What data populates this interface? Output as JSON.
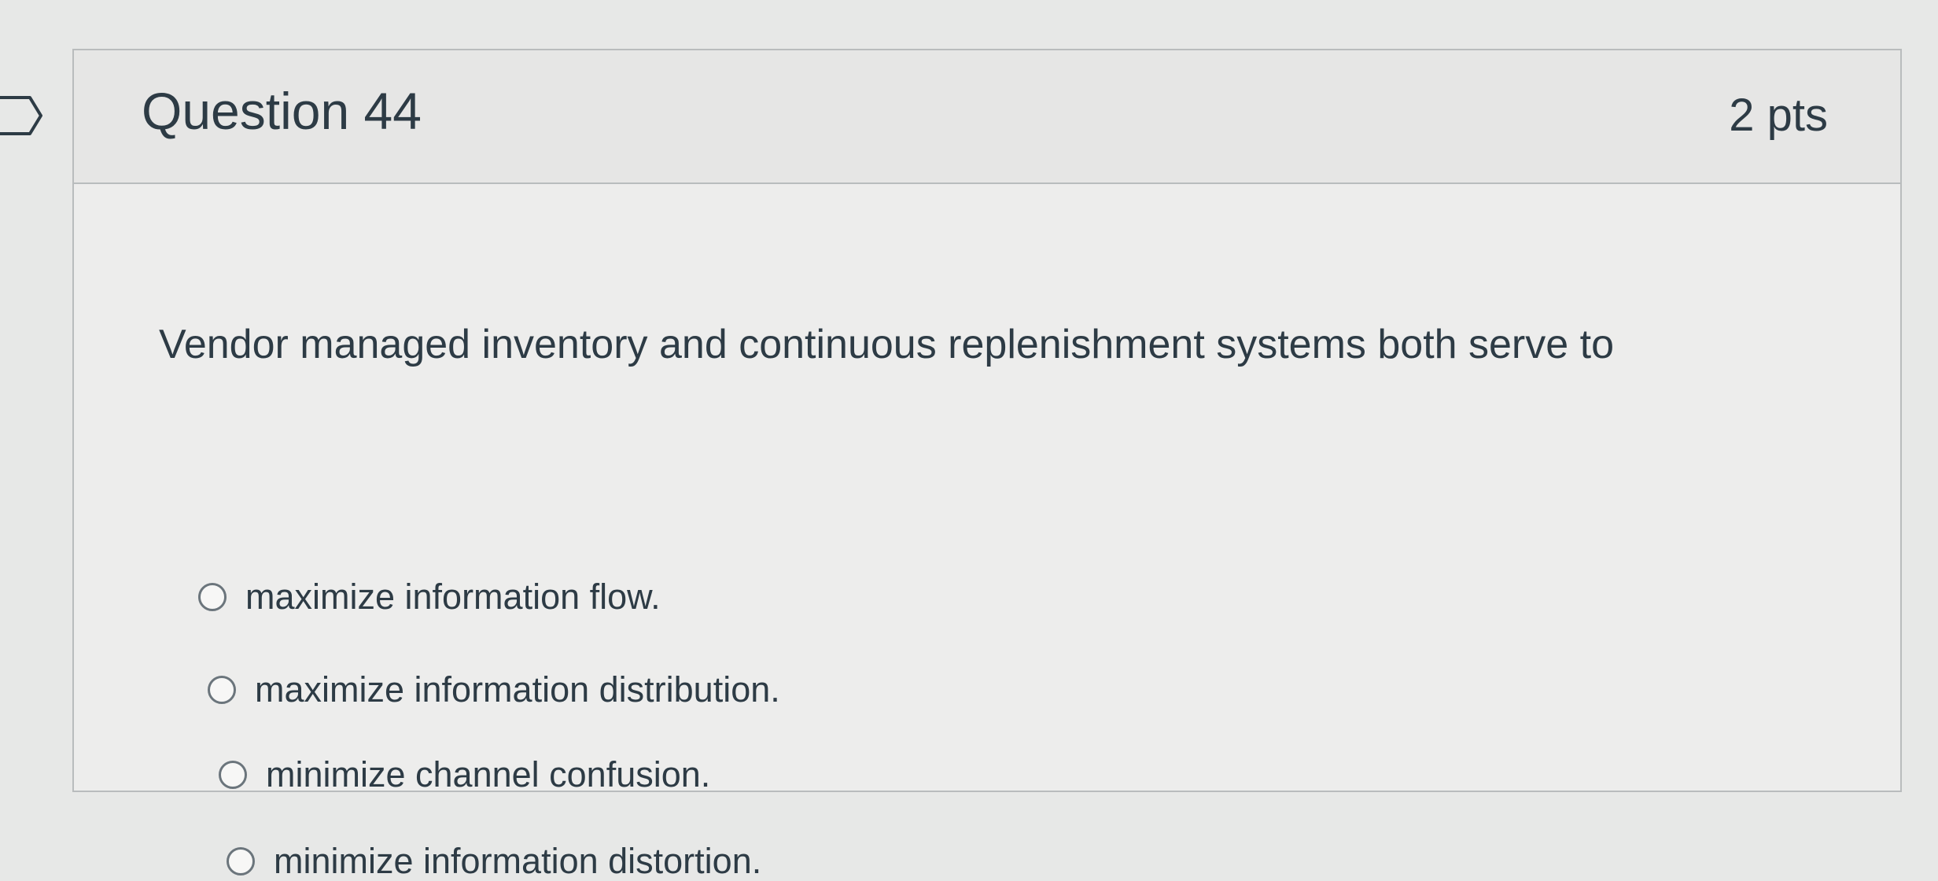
{
  "question": {
    "title": "Question 44",
    "points": "2 pts",
    "text": "Vendor managed inventory and continuous replenishment systems both serve to",
    "answers": [
      {
        "label": "maximize information flow.",
        "selected": false
      },
      {
        "label": "maximize information distribution.",
        "selected": false
      },
      {
        "label": "minimize channel confusion.",
        "selected": false
      },
      {
        "label": "minimize information distortion.",
        "selected": false
      }
    ]
  },
  "icons": {
    "flag": "flag-question-icon",
    "radio": "radio-button-icon"
  },
  "colors": {
    "background": "#e7e8e7",
    "card_background": "#ededec",
    "header_background": "#e6e6e5",
    "border": "#b9bcbd",
    "text": "#2d3b45",
    "radio_border": "#6b757c"
  }
}
